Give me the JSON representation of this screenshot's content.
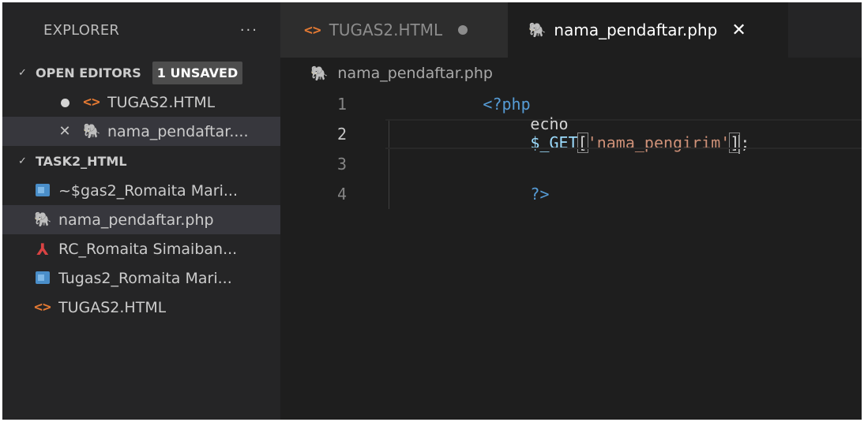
{
  "sidebar": {
    "title": "EXPLORER",
    "more": "···",
    "open_editors": {
      "label": "OPEN EDITORS",
      "badge": "1 UNSAVED",
      "items": [
        {
          "name": "TUGAS2.HTML",
          "state": "unsaved",
          "icon": "html-icon"
        },
        {
          "name": "nama_pendaftar....",
          "state": "close",
          "icon": "php-icon"
        }
      ]
    },
    "folder": {
      "label": "TASK2_HTML",
      "files": [
        {
          "name": "~$gas2_Romaita Mari...",
          "icon": "word-icon"
        },
        {
          "name": "nama_pendaftar.php",
          "icon": "php-icon",
          "selected": true
        },
        {
          "name": "RC_Romaita Simaiban...",
          "icon": "pdf-icon"
        },
        {
          "name": "Tugas2_Romaita Mari...",
          "icon": "word-icon"
        },
        {
          "name": "TUGAS2.HTML",
          "icon": "html-icon"
        }
      ]
    }
  },
  "tabs": [
    {
      "label": "TUGAS2.HTML",
      "icon": "html-icon",
      "active": false,
      "unsaved": true
    },
    {
      "label": "nama_pendaftar.php",
      "icon": "php-icon",
      "active": true,
      "close": "✕"
    }
  ],
  "breadcrumb": "nama_pendaftar.php",
  "code": {
    "line_numbers": [
      "1",
      "2",
      "3",
      "4"
    ],
    "line1": "<?php",
    "line2": {
      "echo": "echo",
      "var": "$_GET",
      "open": "[",
      "string": "'nama_pengirim'",
      "close": "]",
      "semi": ";"
    },
    "line4": "?>"
  },
  "colors": {
    "sidebar_bg": "#252526",
    "editor_bg": "#1e1e1e",
    "keyword": "#569cd6",
    "variable": "#9cdcfe",
    "string": "#ce9178",
    "html_icon": "#e37933",
    "php_icon": "#a074c4"
  }
}
